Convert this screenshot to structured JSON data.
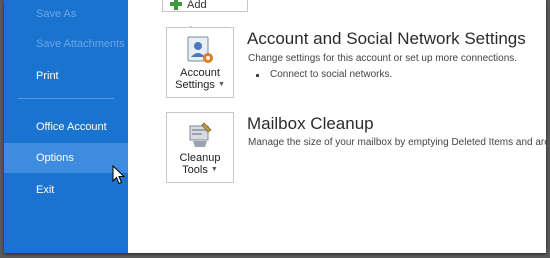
{
  "sidebar": {
    "items": [
      {
        "label": "Save As",
        "state": "disabled"
      },
      {
        "label": "Save Attachments",
        "state": "disabled"
      },
      {
        "label": "Print",
        "state": "normal"
      },
      {
        "label": "Office Account",
        "state": "normal"
      },
      {
        "label": "Options",
        "state": "hover"
      },
      {
        "label": "Exit",
        "state": "normal"
      }
    ]
  },
  "toolbar": {
    "add_account_label": "Add Account"
  },
  "sections": [
    {
      "title": "Account and Social Network Settings",
      "description": "Change settings for this account or set up more connections.",
      "bullets": [
        "Connect to social networks."
      ],
      "tile": {
        "line1": "Account",
        "line2": "Settings",
        "icon": "account-settings-icon"
      }
    },
    {
      "title": "Mailbox Cleanup",
      "description": "Manage the size of your mailbox by emptying Deleted Items and arc",
      "bullets": [],
      "tile": {
        "line1": "Cleanup",
        "line2": "Tools",
        "icon": "cleanup-tools-icon"
      }
    }
  ],
  "colors": {
    "sidebar_bg": "#1a73cf",
    "sidebar_hover": "#3d8ce0",
    "sidebar_disabled_text": "#6aa6e6",
    "accent_green": "#3c9a3c",
    "accent_orange": "#e07b1f"
  }
}
